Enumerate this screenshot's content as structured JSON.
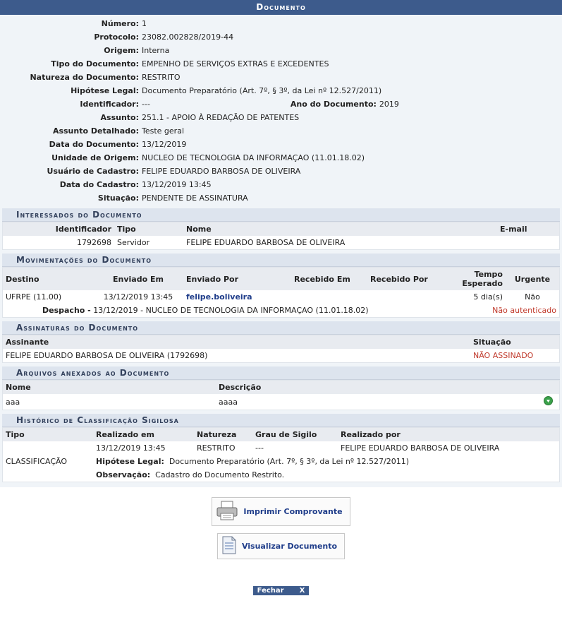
{
  "header": {
    "title": "Documento"
  },
  "fields": [
    {
      "label": "Número:",
      "value": "1"
    },
    {
      "label": "Protocolo:",
      "value": "23082.002828/2019-44"
    },
    {
      "label": "Origem:",
      "value": "Interna"
    },
    {
      "label": "Tipo do Documento:",
      "value": "EMPENHO DE SERVIÇOS EXTRAS E EXCEDENTES"
    },
    {
      "label": "Natureza do Documento:",
      "value": "RESTRITO"
    },
    {
      "label": "Hipótese Legal:",
      "value": "Documento Preparatório (Art. 7º, § 3º, da Lei nº 12.527/2011)"
    },
    {
      "label": "Identificador:",
      "value": "---",
      "label2": "Ano do Documento:",
      "value2": "2019"
    },
    {
      "label": "Assunto:",
      "value": "251.1 - APOIO À REDAÇÃO DE PATENTES"
    },
    {
      "label": "Assunto Detalhado:",
      "value": "Teste geral"
    },
    {
      "label": "Data do Documento:",
      "value": "13/12/2019"
    },
    {
      "label": "Unidade de Origem:",
      "value": "NUCLEO DE TECNOLOGIA DA INFORMAÇAO (11.01.18.02)"
    },
    {
      "label": "Usuário de Cadastro:",
      "value": "FELIPE EDUARDO BARBOSA DE OLIVEIRA"
    },
    {
      "label": "Data do Cadastro:",
      "value": "13/12/2019 13:45"
    },
    {
      "label": "Situação:",
      "value": "PENDENTE DE ASSINATURA"
    }
  ],
  "interessados": {
    "title": "Interessados do Documento",
    "cols": [
      "Identificador",
      "Tipo",
      "Nome",
      "E-mail"
    ],
    "row": [
      "1792698",
      "Servidor",
      "FELIPE EDUARDO BARBOSA DE OLIVEIRA",
      ""
    ]
  },
  "movimentacoes": {
    "title": "Movimentações do Documento",
    "cols": [
      "Destino",
      "Enviado Em",
      "Enviado Por",
      "Recebido Em",
      "Recebido Por",
      "Tempo Esperado",
      "Urgente"
    ],
    "row": [
      "UFRPE (11.00)",
      "13/12/2019 13:45",
      "felipe.boliveira",
      "",
      "",
      "5 dia(s)",
      "Não"
    ],
    "despacho_label": "Despacho -",
    "despacho": "13/12/2019 - NUCLEO DE TECNOLOGIA DA INFORMAÇAO (11.01.18.02)",
    "status": "Não autenticado"
  },
  "assinaturas": {
    "title": "Assinaturas do Documento",
    "cols": [
      "Assinante",
      "Situação"
    ],
    "row": [
      "FELIPE EDUARDO BARBOSA DE OLIVEIRA (1792698)",
      "NÃO ASSINADO"
    ]
  },
  "arquivos": {
    "title": "Arquivos anexados ao Documento",
    "cols": [
      "Nome",
      "Descrição"
    ],
    "row": [
      "aaa",
      "aaaa"
    ]
  },
  "historico": {
    "title": "Histórico de Classificação Sigilosa",
    "cols": [
      "Tipo",
      "Realizado em",
      "Natureza",
      "Grau de Sigilo",
      "Realizado por"
    ],
    "row": [
      "CLASSIFICAÇÃO",
      "13/12/2019 13:45",
      "RESTRITO",
      "---",
      "FELIPE EDUARDO BARBOSA DE OLIVEIRA"
    ],
    "hip_label": "Hipótese Legal:",
    "hip": "Documento Preparatório (Art. 7º, § 3º, da Lei nº 12.527/2011)",
    "obs_label": "Observação:",
    "obs": "Cadastro do Documento Restrito."
  },
  "buttons": {
    "imprimir": "Imprimir Comprovante",
    "visualizar": "Visualizar Documento",
    "fechar": "Fechar",
    "fechar_x": "X"
  },
  "icons": [
    "printer-icon",
    "document-icon",
    "download-icon"
  ]
}
